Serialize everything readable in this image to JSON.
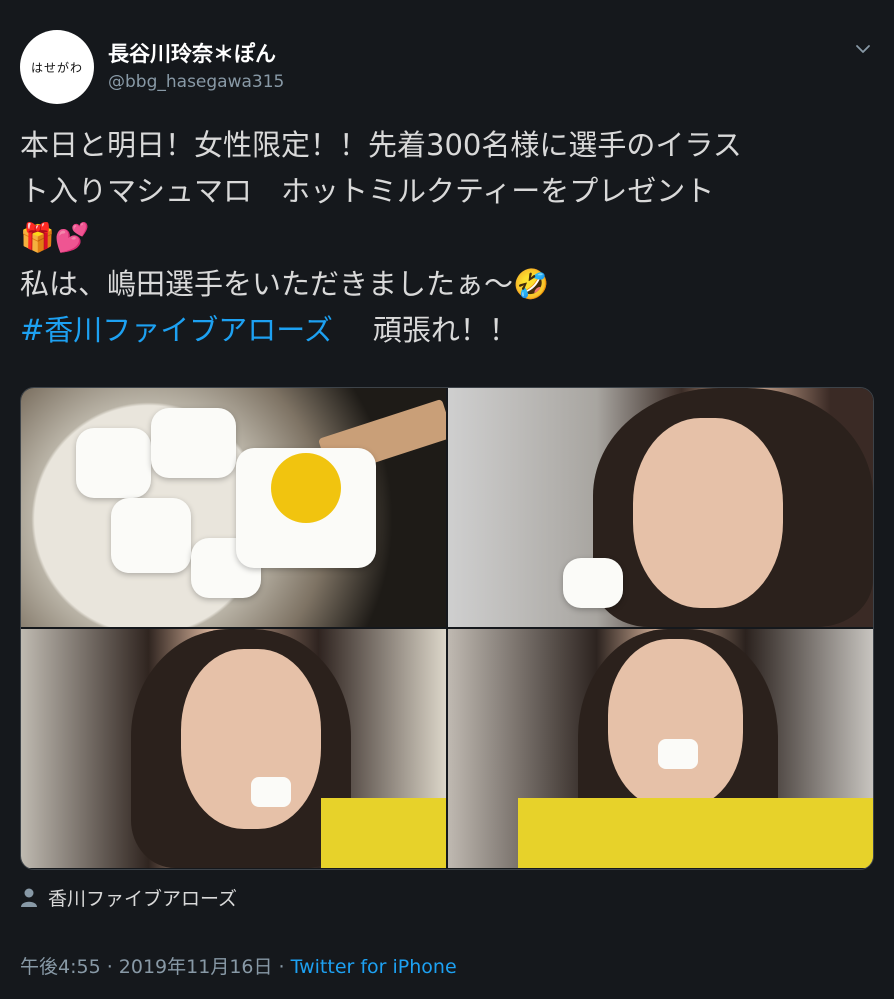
{
  "author": {
    "display_name": "長谷川玲奈＊ぽん",
    "handle": "@bbg_hasegawa315",
    "avatar_text": "はせがわ"
  },
  "tweet": {
    "line1": "本日と明日！女性限定！！先着300名様に選手のイラス",
    "line2": "ト入りマシュマロ　ホットミルクティーをプレゼント",
    "line3_emojis": "🎁💕",
    "line4": "私は、嶋田選手をいただきましたぁ〜🤣",
    "hashtag": "#香川ファイブアローズ",
    "line5_rest": "頑張れ！！"
  },
  "location": "香川ファイブアローズ",
  "meta": {
    "time": "午後4:55",
    "separator": " · ",
    "date": "2019年11月16日",
    "source": "Twitter for iPhone"
  },
  "icons": {
    "caret": "chevron-down-icon",
    "location": "person-icon"
  },
  "colors": {
    "background": "#15181c",
    "link": "#1da1f2",
    "muted": "#8899a6",
    "text": "#d9d9d9"
  }
}
